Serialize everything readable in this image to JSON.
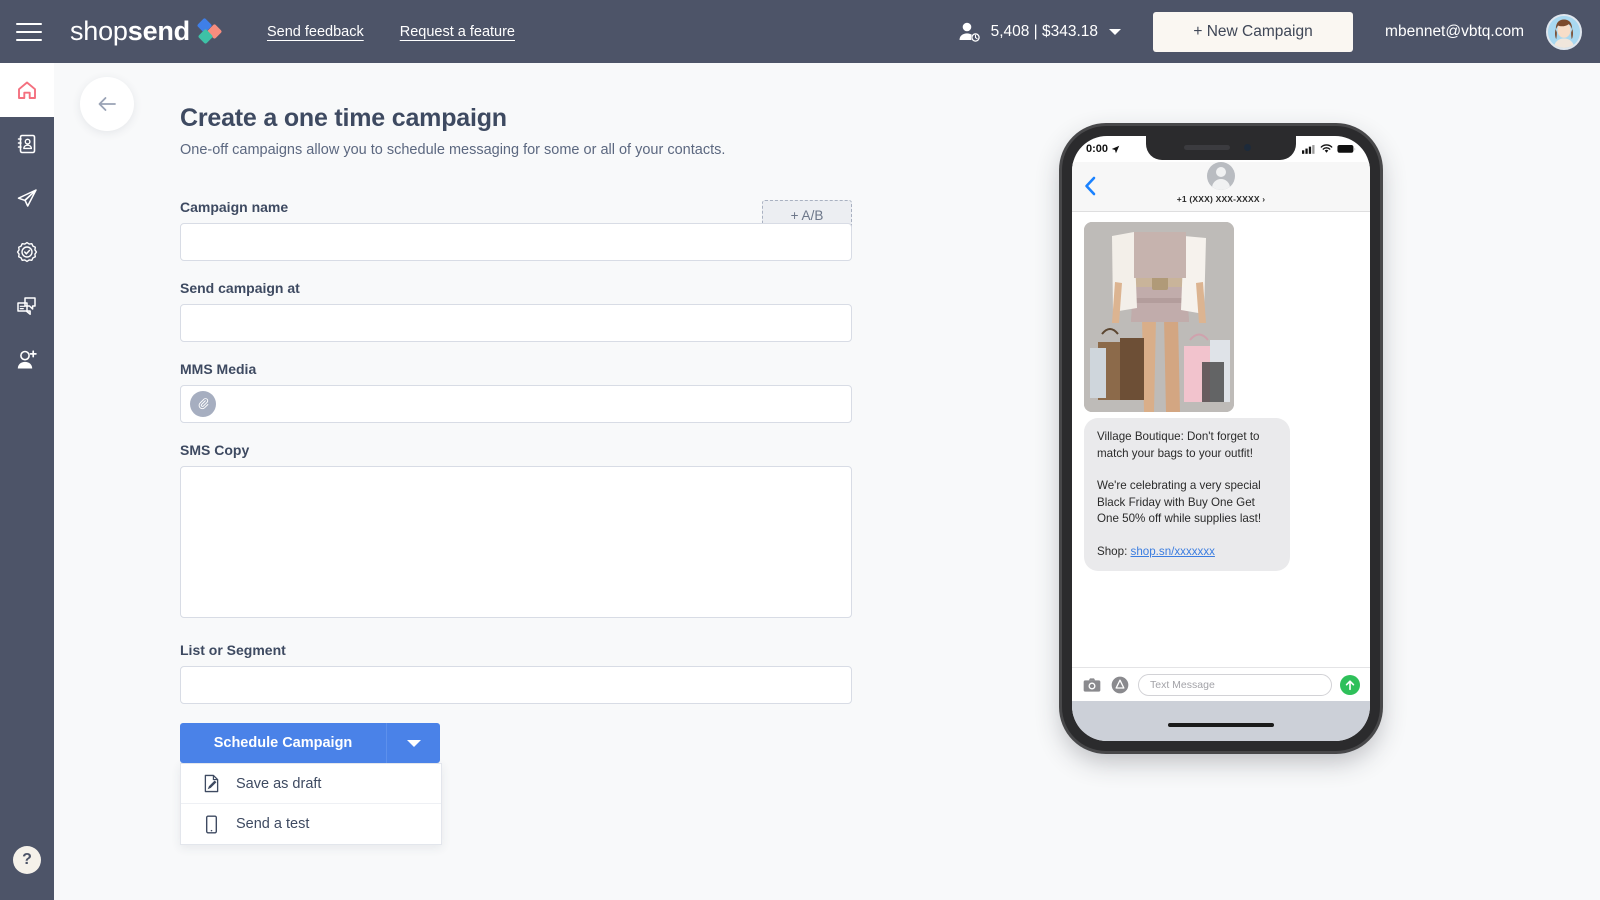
{
  "header": {
    "menu_icon": "hamburger-icon",
    "brand": {
      "light": "shop",
      "bold": "send"
    },
    "links": [
      {
        "label": "Send feedback",
        "name": "send-feedback-link"
      },
      {
        "label": "Request a feature",
        "name": "request-feature-link"
      }
    ],
    "credits": {
      "icon": "contact-clock-icon",
      "value": "5,408 | $343.18"
    },
    "new_campaign_label": "+ New Campaign",
    "account_email": "mbennet@vbtq.com",
    "avatar_icon": "user-avatar"
  },
  "sidebar": {
    "items": [
      {
        "name": "sidebar-item-home",
        "icon": "home-icon",
        "active": true
      },
      {
        "name": "sidebar-item-contacts",
        "icon": "address-book-icon",
        "active": false
      },
      {
        "name": "sidebar-item-campaigns",
        "icon": "paper-plane-icon",
        "active": false
      },
      {
        "name": "sidebar-item-automations",
        "icon": "gear-check-icon",
        "active": false
      },
      {
        "name": "sidebar-item-conversations",
        "icon": "chat-bubbles-icon",
        "active": false
      },
      {
        "name": "sidebar-item-add-user",
        "icon": "add-user-icon",
        "active": false
      }
    ],
    "help_label": "?"
  },
  "main": {
    "back_icon": "arrow-left-icon",
    "title": "Create a one time campaign",
    "subtitle": "One-off campaigns allow you to schedule messaging for some or all of your contacts.",
    "ab_button_label": "+ A/B",
    "fields": {
      "campaign_name": {
        "label": "Campaign name",
        "value": "",
        "placeholder": ""
      },
      "send_campaign_at": {
        "label": "Send campaign at",
        "value": "",
        "placeholder": ""
      },
      "mms_media": {
        "label": "MMS Media",
        "value": "",
        "placeholder": "",
        "attach_icon": "paperclip-icon"
      },
      "sms_copy": {
        "label": "SMS Copy",
        "value": "",
        "placeholder": ""
      },
      "list_or_segment": {
        "label": "List or Segment",
        "value": "",
        "placeholder": ""
      }
    },
    "actions": {
      "primary_label": "Schedule Campaign",
      "dropdown_icon": "chevron-down-icon",
      "menu": [
        {
          "label": "Save as draft",
          "icon": "document-pencil-icon",
          "name": "menu-item-save-as-draft"
        },
        {
          "label": "Send a test",
          "icon": "mobile-device-icon",
          "name": "menu-item-send-a-test"
        }
      ]
    }
  },
  "preview": {
    "status_bar": {
      "time": "0:00",
      "location_icon": "location-arrow-icon",
      "signal_icon": "cellular-icon",
      "wifi_icon": "wifi-icon",
      "battery_icon": "battery-icon"
    },
    "conversation": {
      "back_icon": "chevron-left-icon",
      "contact_avatar_icon": "contact-avatar-icon",
      "contact_number": "+1 (XXX) XXX-XXXX"
    },
    "message": {
      "image_alt": "woman-with-shopping-bags-photo",
      "line1": "Village Boutique: Don't forget to match your bags to your outfit!",
      "line2": "We're celebrating a very special Black Friday with Buy One Get One 50% off while supplies last!",
      "shop_prefix": "Shop: ",
      "shop_link": "shop.sn/xxxxxxx"
    },
    "input_bar": {
      "camera_icon": "camera-icon",
      "appstore_icon": "app-store-icon",
      "placeholder": "Text Message",
      "send_icon": "send-arrow-icon"
    }
  },
  "colors": {
    "header_bg": "#4d5468",
    "accent_blue": "#4a82e8",
    "active_pink": "#f4707f",
    "page_bg": "#f8f9fa"
  }
}
